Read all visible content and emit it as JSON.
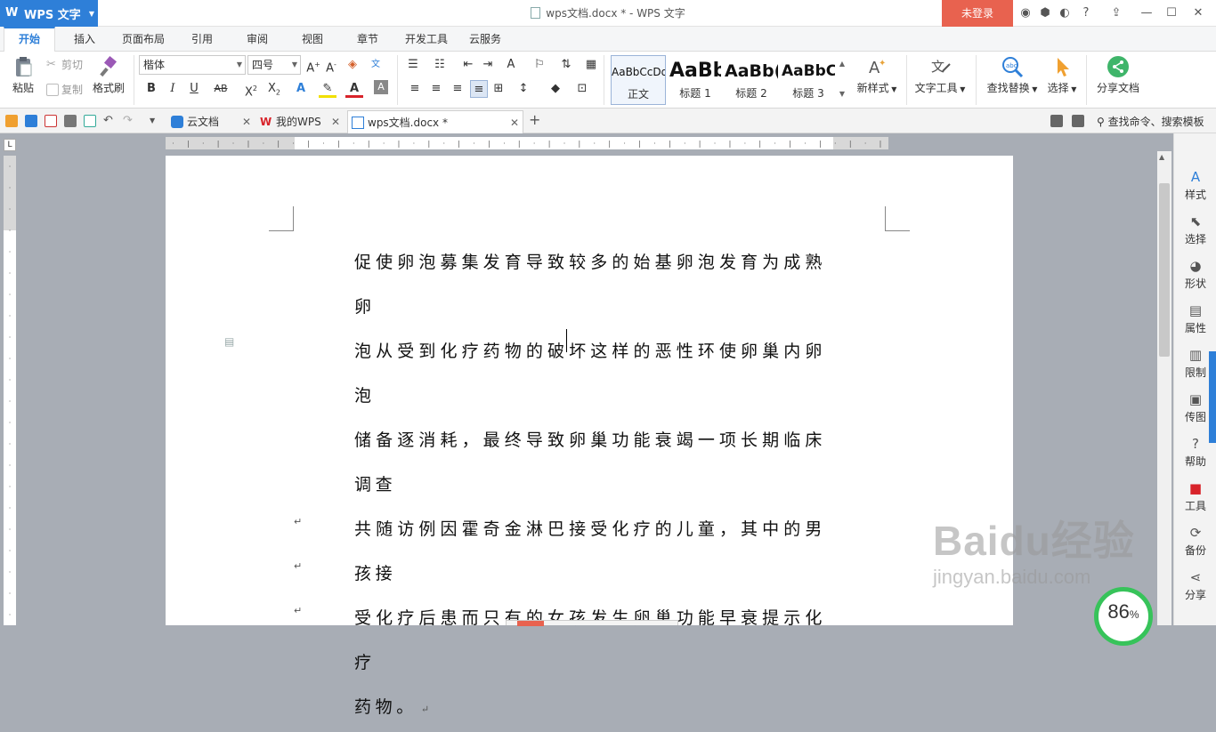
{
  "titlebar": {
    "app_name": "WPS 文字",
    "window_title": "wps文档.docx * - WPS 文字",
    "login_label": "未登录"
  },
  "menu": {
    "items": [
      "开始",
      "插入",
      "页面布局",
      "引用",
      "审阅",
      "视图",
      "章节",
      "开发工具",
      "云服务"
    ]
  },
  "ribbon": {
    "paste_label": "粘贴",
    "cut_label": "剪切",
    "copy_label": "复制",
    "format_painter_label": "格式刷",
    "font_name": "楷体",
    "font_size": "四号",
    "styles": [
      {
        "preview": "AaBbCcDd",
        "label": "正文"
      },
      {
        "preview": "AaBb",
        "label": "标题 1"
      },
      {
        "preview": "AaBb(",
        "label": "标题 2"
      },
      {
        "preview": "AaBbC",
        "label": "标题 3"
      }
    ],
    "new_style_label": "新样式",
    "text_tools_label": "文字工具",
    "find_replace_label": "查找替换",
    "select_label": "选择",
    "share_label": "分享文档"
  },
  "tabs": {
    "items": [
      "云文档",
      "我的WPS",
      "wps文档.docx *"
    ],
    "search_label": "查找命令、搜索模板"
  },
  "document": {
    "lines": [
      "促使卵泡募集发育导致较多的始基卵泡发育为成熟卵",
      "泡从受到化疗药物的破坏这样的恶性环使卵巢内卵泡",
      "储备逐消耗，最终导致卵巢功能衰竭一项长期临床调查",
      "共随访例因霍奇金淋巴接受化疗的儿童，其中的男孩接",
      "受化疗后患而只有的女孩发生卵巢功能早衰提示化疗",
      "药物。"
    ],
    "paragraph_mark": "↵"
  },
  "right_panel": {
    "items": [
      "样式",
      "选择",
      "形状",
      "属性",
      "限制",
      "传图",
      "帮助",
      "工具",
      "备份",
      "分享"
    ]
  },
  "zoom": {
    "value": "86",
    "unit": "%"
  },
  "watermark": {
    "main": "Baidu经验",
    "sub": "jingyan.baidu.com"
  },
  "colors": {
    "accent": "#2e7fd8",
    "login": "#e8624f",
    "zoom_ring": "#37c35a"
  }
}
